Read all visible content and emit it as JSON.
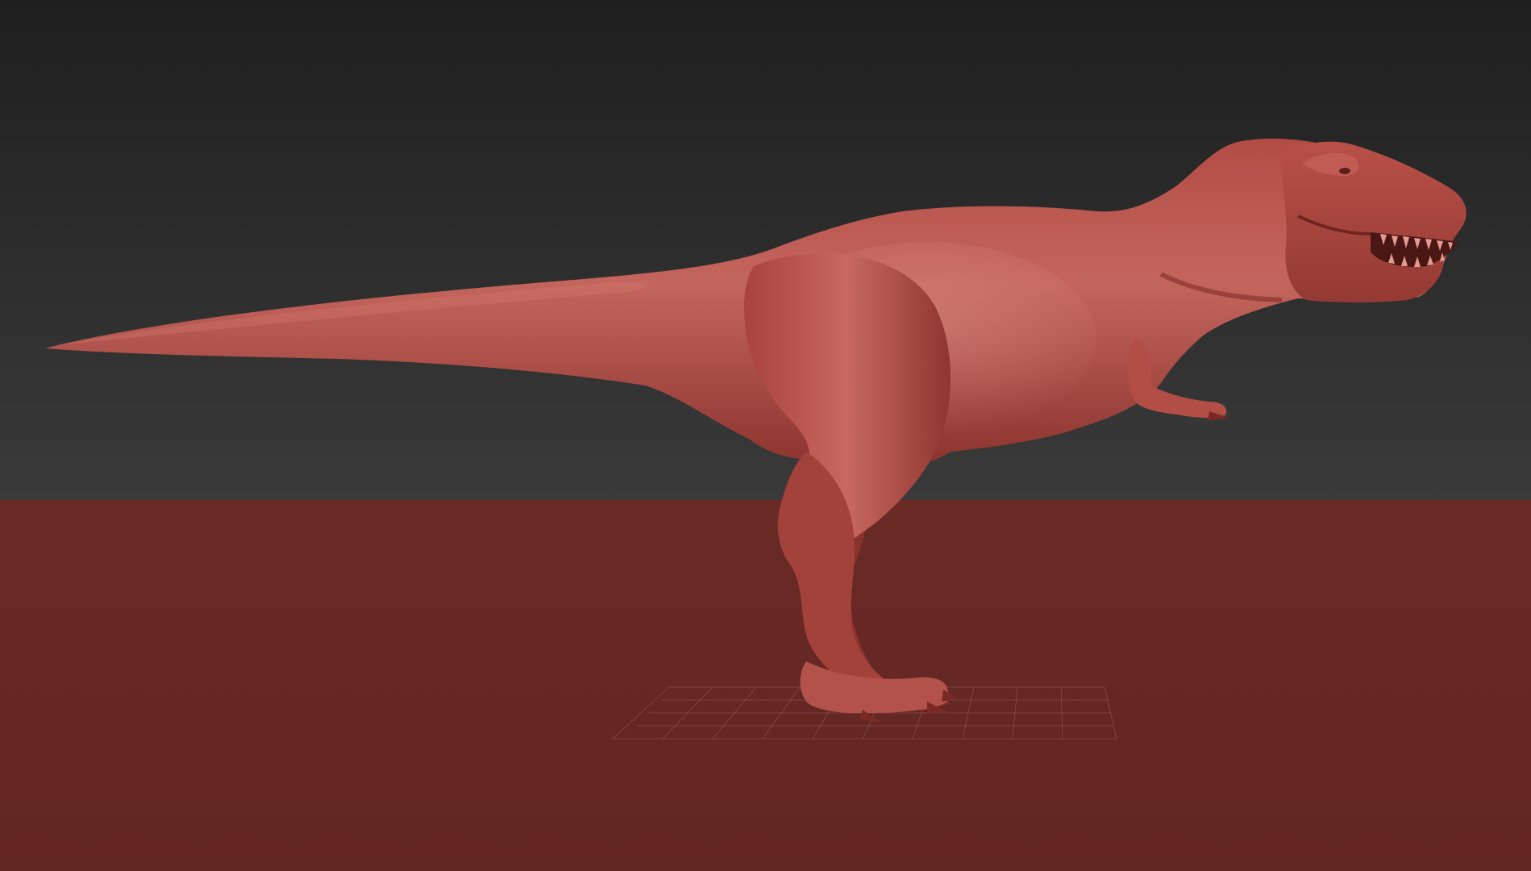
{
  "viewport": {
    "background_top_color": "#1f1f1f",
    "background_bottom_color": "#3a3a3a",
    "floor_color": "#662825",
    "grid_color": "#9a6a66"
  },
  "model": {
    "subject": "tyrannosaurus-sculpt",
    "material_color": "#b8504a",
    "material_highlight_color": "#d67a72",
    "material_shadow_color": "#6e2621",
    "pose": "standing-side-view-facing-right",
    "mouth": "open"
  }
}
